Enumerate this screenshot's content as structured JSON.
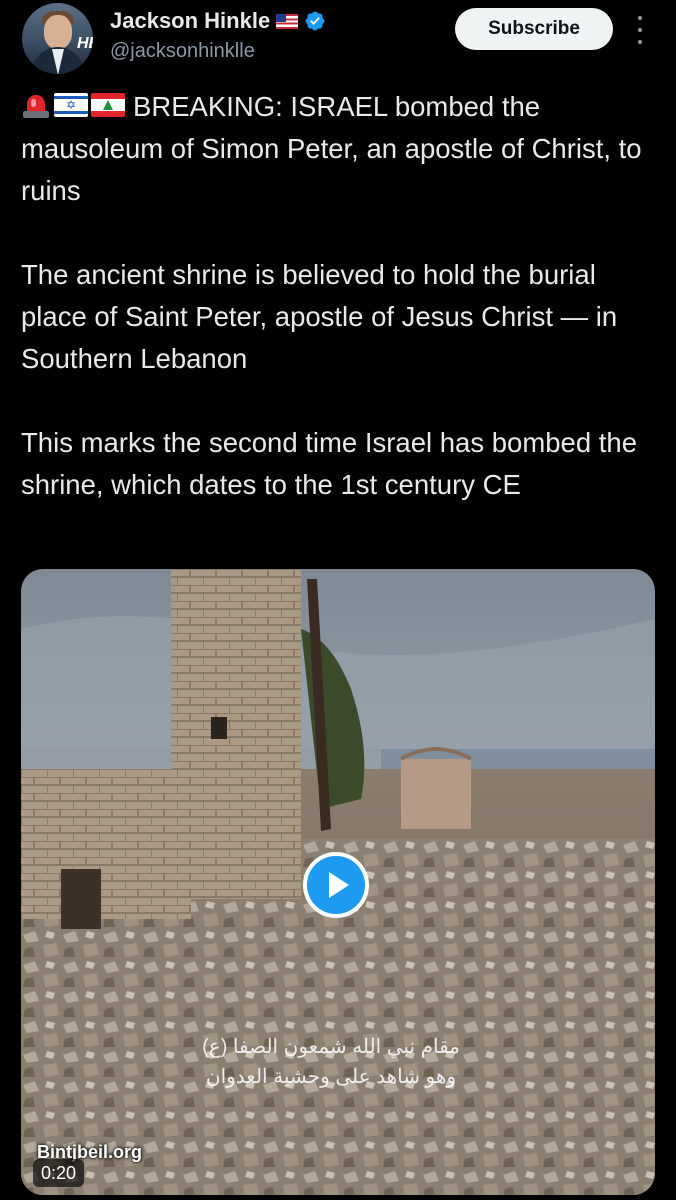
{
  "author": {
    "name": "Jackson Hinkle",
    "handle": "@jacksonhinklle",
    "avatar_badge": "HB",
    "flag_icon": "us-flag-icon",
    "verified_icon": "verified-badge-icon",
    "verified_color": "#1d9bf0"
  },
  "actions": {
    "subscribe_label": "Subscribe",
    "more_icon": "more-vertical-icon"
  },
  "tweet": {
    "emojis": [
      "police-siren-emoji",
      "israel-flag-emoji",
      "lebanon-flag-emoji"
    ],
    "paragraphs": [
      "BREAKING: ISRAEL bombed the mausoleum of Simon Peter, an apostle of Christ, to ruins",
      "The ancient shrine is believed to hold the burial place of Saint Peter, apostle of Jesus Christ — in Southern Lebanon",
      "This marks the second time Israel has bombed the shrine, which dates to the 1st century CE"
    ]
  },
  "media": {
    "type": "video",
    "watermark": "Bintjbeil.org",
    "duration": "0:20",
    "caption_lines": [
      "مقام نبي الله شمعون الصفا (ع)",
      "وهو شاهد على وحشية العدوان"
    ],
    "play_icon": "play-icon",
    "play_color": "#1d9bf0"
  },
  "colors": {
    "background": "#000000",
    "text": "#e7e9ea",
    "secondary_text": "#8b98a5",
    "button_bg": "#eff3f4",
    "button_text": "#0f1419"
  }
}
